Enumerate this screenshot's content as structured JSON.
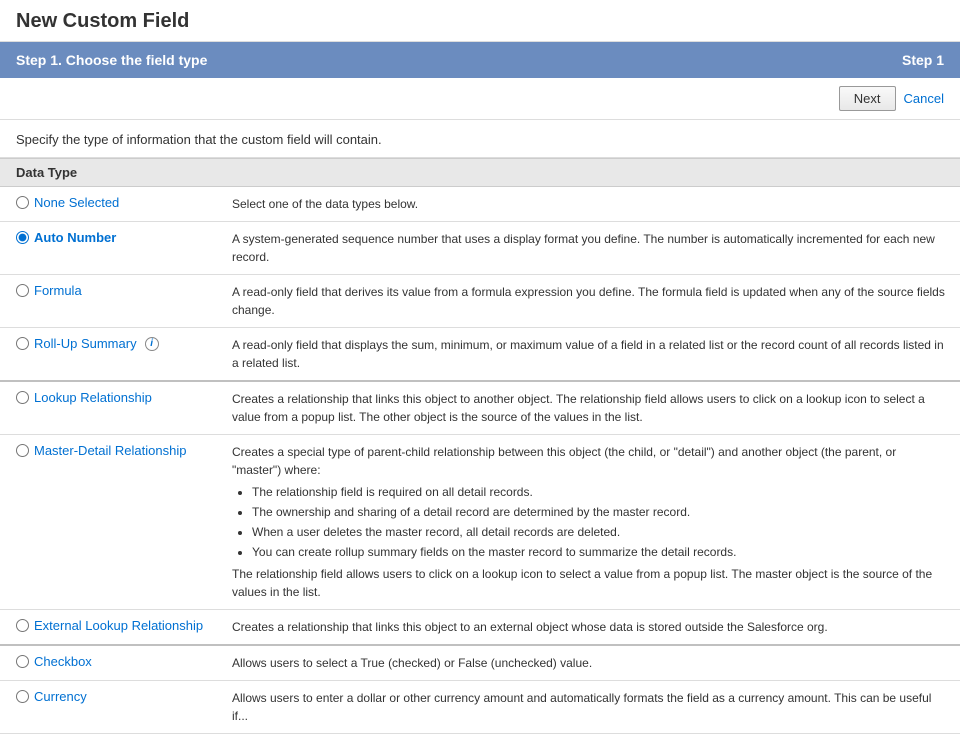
{
  "page": {
    "title": "New Custom Field",
    "step_header": "Step 1. Choose the field type",
    "step_label": "Step 1",
    "description": "Specify the type of information that the custom field will contain.",
    "next_button": "Next",
    "cancel_link": "Cancel",
    "table_header": "Data Type"
  },
  "data_types": [
    {
      "id": "none",
      "label": "None Selected",
      "description": "Select one of the data types below.",
      "selected": false,
      "has_info": false,
      "group": "special"
    },
    {
      "id": "auto_number",
      "label": "Auto Number",
      "description": "A system-generated sequence number that uses a display format you define. The number is automatically incremented for each new record.",
      "selected": true,
      "has_info": false,
      "group": "special"
    },
    {
      "id": "formula",
      "label": "Formula",
      "description": "A read-only field that derives its value from a formula expression you define. The formula field is updated when any of the source fields change.",
      "selected": false,
      "has_info": false,
      "group": "special"
    },
    {
      "id": "roll_up_summary",
      "label": "Roll-Up Summary",
      "description": "A read-only field that displays the sum, minimum, or maximum value of a field in a related list or the record count of all records listed in a related list.",
      "selected": false,
      "has_info": true,
      "group": "special_last"
    },
    {
      "id": "lookup_relationship",
      "label": "Lookup Relationship",
      "description": "Creates a relationship that links this object to another object. The relationship field allows users to click on a lookup icon to select a value from a popup list. The other object is the source of the values in the list.",
      "selected": false,
      "has_info": false,
      "group": "relationship"
    },
    {
      "id": "master_detail",
      "label": "Master-Detail Relationship",
      "description": "Creates a special type of parent-child relationship between this object (the child, or \"detail\") and another object (the parent, or \"master\") where:",
      "bullets": [
        "The relationship field is required on all detail records.",
        "The ownership and sharing of a detail record are determined by the master record.",
        "When a user deletes the master record, all detail records are deleted.",
        "You can create rollup summary fields on the master record to summarize the detail records."
      ],
      "extra_text": "The relationship field allows users to click on a lookup icon to select a value from a popup list. The master object is the source of the values in the list.",
      "selected": false,
      "has_info": false,
      "group": "relationship"
    },
    {
      "id": "external_lookup",
      "label": "External Lookup Relationship",
      "description": "Creates a relationship that links this object to an external object whose data is stored outside the Salesforce org.",
      "selected": false,
      "has_info": false,
      "group": "relationship_last"
    },
    {
      "id": "checkbox",
      "label": "Checkbox",
      "description": "Allows users to select a True (checked) or False (unchecked) value.",
      "selected": false,
      "has_info": false,
      "group": "basic"
    },
    {
      "id": "currency",
      "label": "Currency",
      "description": "Allows users to enter a dollar or other currency amount and automatically formats the field as a currency amount. This can be useful if...",
      "selected": false,
      "has_info": false,
      "group": "basic"
    }
  ]
}
